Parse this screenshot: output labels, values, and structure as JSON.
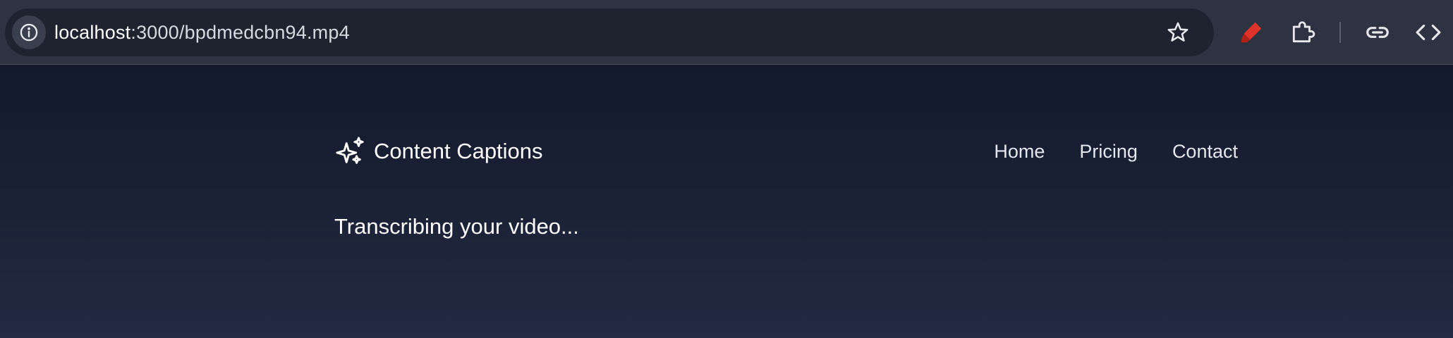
{
  "browser": {
    "url_host": "localhost",
    "url_path": ":3000/bpdmedcbn94.mp4",
    "icons": {
      "site_info": "info-icon",
      "bookmark": "star-icon",
      "extension_1": "highlighter-icon",
      "extension_2": "puzzle-icon",
      "share": "link-icon",
      "devtools": "code-icon"
    },
    "accent": "#e0342a"
  },
  "header": {
    "brand_icon": "sparkles-icon",
    "brand_name": "Content Captions",
    "nav": {
      "home": "Home",
      "pricing": "Pricing",
      "contact": "Contact"
    }
  },
  "main": {
    "status_text": "Transcribing your video..."
  }
}
